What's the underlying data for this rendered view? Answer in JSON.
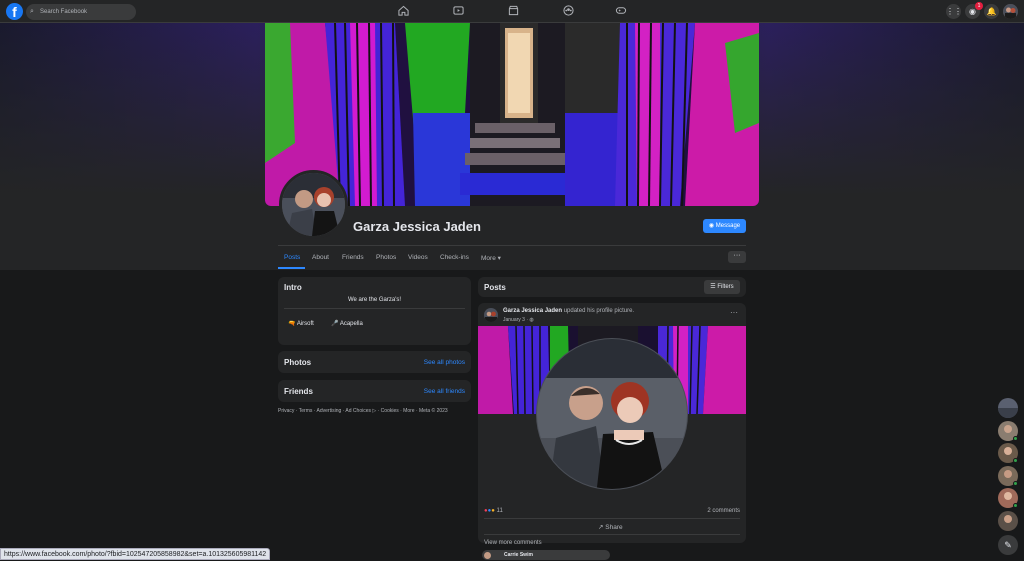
{
  "topbar": {
    "logo": "f",
    "search_placeholder": "Search Facebook",
    "nav_icons": [
      "home-icon",
      "watch-icon",
      "marketplace-icon",
      "groups-icon",
      "gaming-icon"
    ],
    "right_icons": [
      "menu-grid-icon",
      "messenger-icon",
      "bell-icon",
      "account-avatar"
    ],
    "messenger_badge": "1"
  },
  "profile": {
    "name": "Garza Jessica Jaden",
    "message_button": "Message",
    "tabs": [
      "Posts",
      "About",
      "Friends",
      "Photos",
      "Videos",
      "Check-ins",
      "More ▾"
    ],
    "more_menu": "···"
  },
  "intro": {
    "title": "Intro",
    "bio": "We are the Garza's!",
    "hobbies": [
      {
        "icon": "airsoft-icon",
        "label": "Airsoft",
        "emoji": "🔫"
      },
      {
        "icon": "acapella-icon",
        "label": "Acapella",
        "emoji": "🎤"
      }
    ]
  },
  "photos": {
    "title": "Photos",
    "link": "See all photos"
  },
  "friends": {
    "title": "Friends",
    "link": "See all friends"
  },
  "footer": "Privacy · Terms · Advertising · Ad Choices ▷ · Cookies · More · Meta © 2023",
  "posts_header": {
    "title": "Posts",
    "filters": "Filters"
  },
  "post": {
    "author": "Garza Jessica Jaden",
    "action": " updated his profile picture.",
    "date": "January 3 · ",
    "reaction_count": "11",
    "comments": "2 comments",
    "share": "Share",
    "view_more": "View more comments",
    "commenter": "Carrie Swim"
  },
  "status_url": "https://www.facebook.com/photo/?fbid=102547205858982&set=a.101325605981142",
  "colors": {
    "accent": "#2d88ff",
    "bg": "#18191a",
    "card": "#242526"
  }
}
